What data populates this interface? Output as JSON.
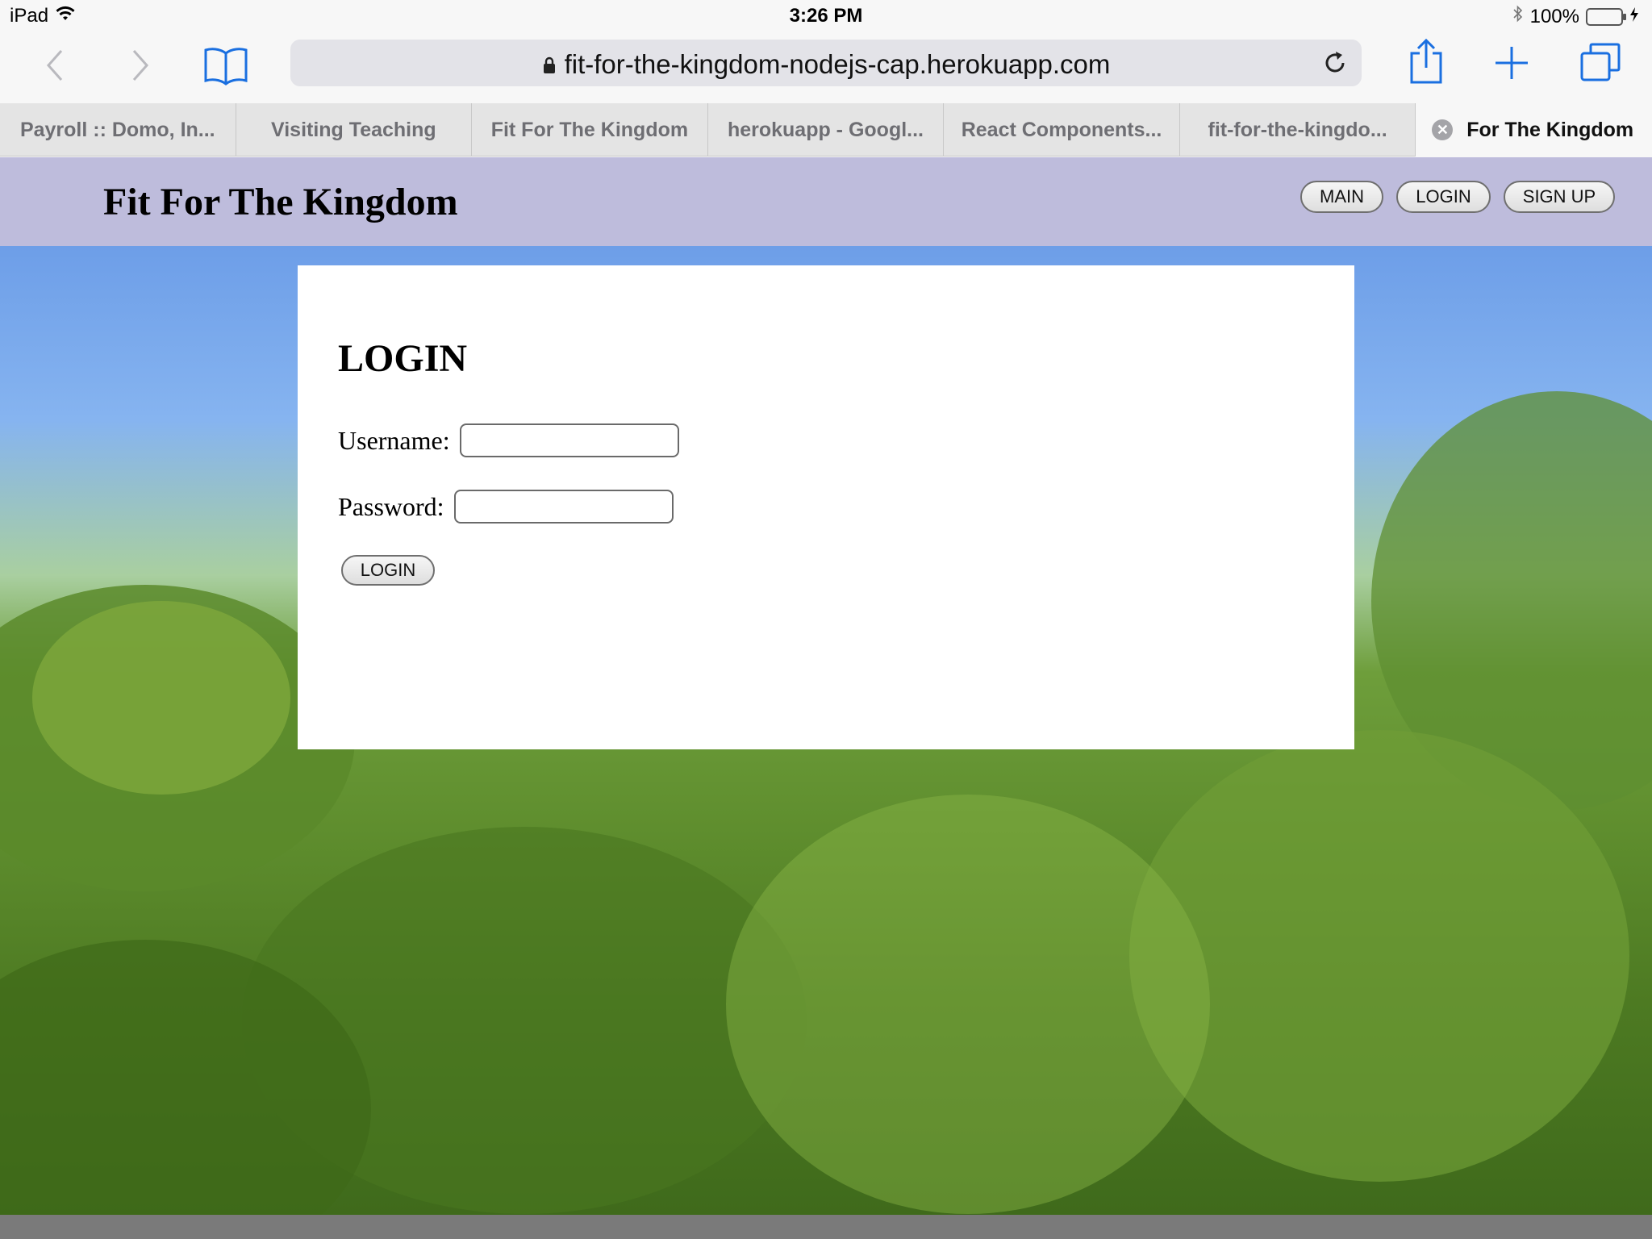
{
  "status_bar": {
    "device": "iPad",
    "time": "3:26 PM",
    "battery": "100%"
  },
  "browser": {
    "url": "fit-for-the-kingdom-nodejs-cap.herokuapp.com",
    "tabs": [
      {
        "label": "Payroll :: Domo, In..."
      },
      {
        "label": "Visiting Teaching"
      },
      {
        "label": "Fit For The Kingdom"
      },
      {
        "label": "herokuapp - Googl..."
      },
      {
        "label": "React Components..."
      },
      {
        "label": "fit-for-the-kingdo..."
      },
      {
        "label": "For The Kingdom"
      }
    ]
  },
  "site": {
    "title": "Fit For The Kingdom",
    "nav": {
      "main": "MAIN",
      "login": "LOGIN",
      "signup": "SIGN UP"
    }
  },
  "login_form": {
    "heading": "LOGIN",
    "username_label": "Username:",
    "username_value": "",
    "password_label": "Password:",
    "password_value": "",
    "submit_label": "LOGIN"
  }
}
